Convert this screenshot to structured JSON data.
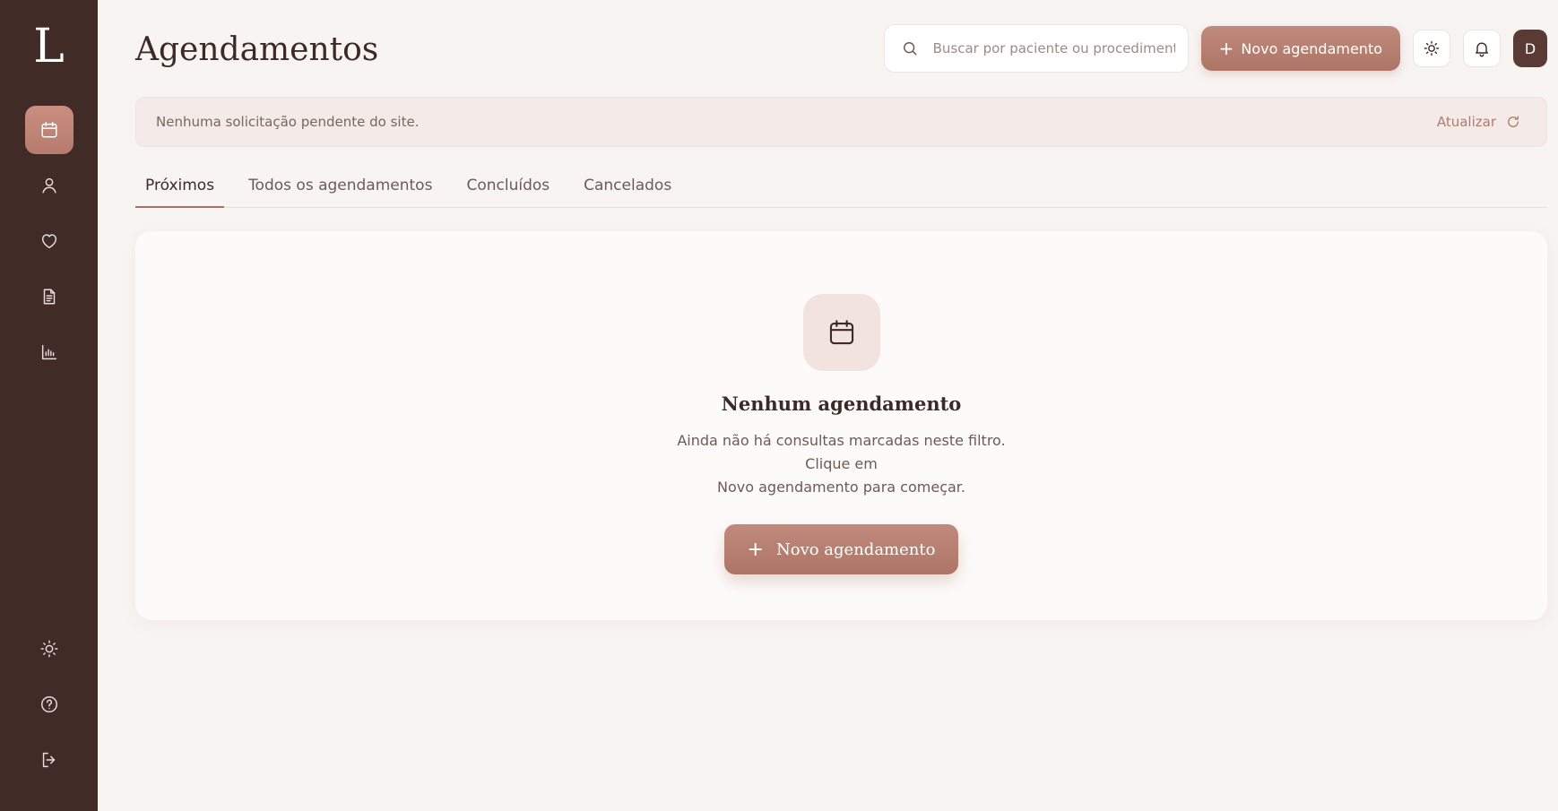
{
  "sidebar": {
    "logo": "L",
    "nav": [
      {
        "name": "calendar-icon",
        "active": true
      },
      {
        "name": "user-icon"
      },
      {
        "name": "heart-icon"
      },
      {
        "name": "document-icon"
      },
      {
        "name": "chart-icon"
      }
    ],
    "bottom": [
      {
        "name": "sun-icon"
      },
      {
        "name": "help-icon"
      },
      {
        "name": "logout-icon"
      }
    ]
  },
  "header": {
    "title": "Agendamentos",
    "search_placeholder": "Buscar por paciente ou procedimento",
    "new_button": "Novo agendamento",
    "avatar": "D"
  },
  "notice": {
    "text": "Nenhuma solicitação pendente do site.",
    "refresh": "Atualizar"
  },
  "tabs": [
    {
      "label": "Próximos",
      "active": true
    },
    {
      "label": "Todos os agendamentos"
    },
    {
      "label": "Concluídos"
    },
    {
      "label": "Cancelados"
    }
  ],
  "empty": {
    "title": "Nenhum agendamento",
    "line1": "Ainda não há consultas marcadas neste filtro. Clique em",
    "line2": "Novo agendamento para começar.",
    "button": "Novo agendamento"
  },
  "colors": {
    "sidebar": "#402b27",
    "accent": "#b57c6e",
    "background": "#f8f4f2"
  }
}
